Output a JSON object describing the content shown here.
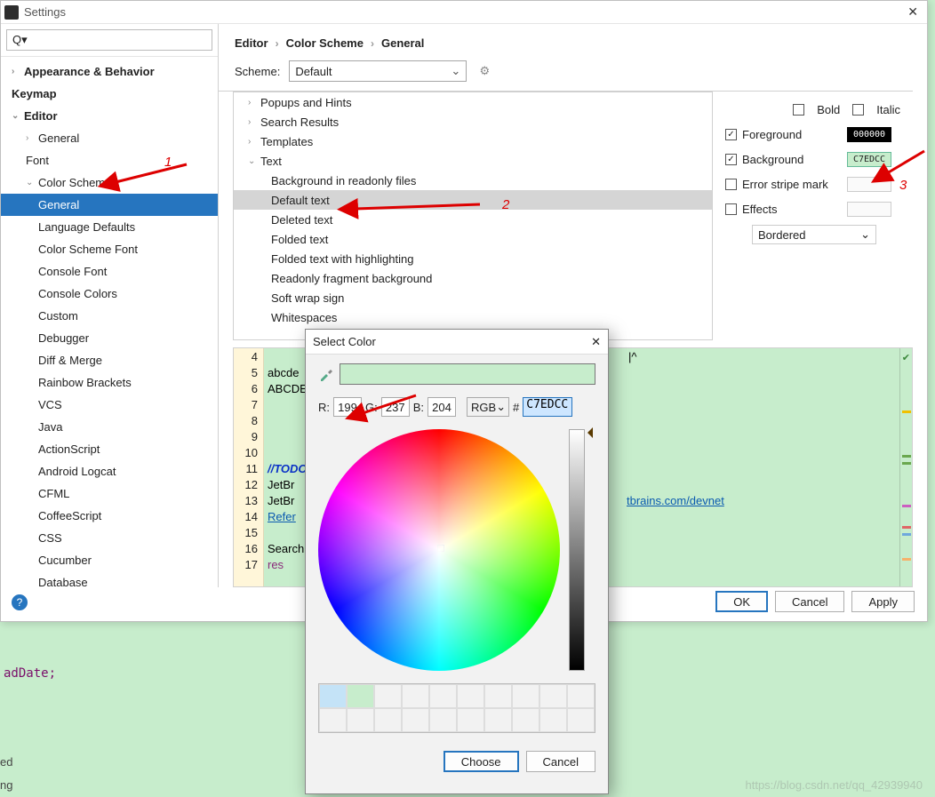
{
  "window": {
    "title": "Settings"
  },
  "search": {
    "placeholder": "Q▾"
  },
  "sidebar": {
    "items": [
      {
        "label": "Appearance & Behavior",
        "bold": true,
        "chev": ">",
        "lvl": 0
      },
      {
        "label": "Keymap",
        "bold": true,
        "lvl": 0
      },
      {
        "label": "Editor",
        "bold": true,
        "chev": "v",
        "lvl": 0
      },
      {
        "label": "General",
        "chev": ">",
        "lvl": 1
      },
      {
        "label": "Font",
        "lvl": 1
      },
      {
        "label": "Color Scheme",
        "chev": "v",
        "lvl": 1
      },
      {
        "label": "General",
        "lvl": 2,
        "sel": true
      },
      {
        "label": "Language Defaults",
        "lvl": 2
      },
      {
        "label": "Color Scheme Font",
        "lvl": 2
      },
      {
        "label": "Console Font",
        "lvl": 2
      },
      {
        "label": "Console Colors",
        "lvl": 2
      },
      {
        "label": "Custom",
        "lvl": 2
      },
      {
        "label": "Debugger",
        "lvl": 2
      },
      {
        "label": "Diff & Merge",
        "lvl": 2
      },
      {
        "label": "Rainbow Brackets",
        "lvl": 2
      },
      {
        "label": "VCS",
        "lvl": 2
      },
      {
        "label": "Java",
        "lvl": 2
      },
      {
        "label": "ActionScript",
        "lvl": 2
      },
      {
        "label": "Android Logcat",
        "lvl": 2
      },
      {
        "label": "CFML",
        "lvl": 2
      },
      {
        "label": "CoffeeScript",
        "lvl": 2
      },
      {
        "label": "CSS",
        "lvl": 2
      },
      {
        "label": "Cucumber",
        "lvl": 2
      },
      {
        "label": "Database",
        "lvl": 2
      }
    ]
  },
  "breadcrumbs": [
    "Editor",
    "Color Scheme",
    "General"
  ],
  "scheme": {
    "label": "Scheme:",
    "value": "Default"
  },
  "categories": [
    {
      "label": "Popups and Hints",
      "chev": ">"
    },
    {
      "label": "Search Results",
      "chev": ">"
    },
    {
      "label": "Templates",
      "chev": ">"
    },
    {
      "label": "Text",
      "chev": "v"
    },
    {
      "label": "Background in readonly files",
      "l": 1
    },
    {
      "label": "Default text",
      "l": 1,
      "sel": true
    },
    {
      "label": "Deleted text",
      "l": 1
    },
    {
      "label": "Folded text",
      "l": 1
    },
    {
      "label": "Folded text with highlighting",
      "l": 1
    },
    {
      "label": "Readonly fragment background",
      "l": 1
    },
    {
      "label": "Soft wrap sign",
      "l": 1
    },
    {
      "label": "Whitespaces",
      "l": 1
    }
  ],
  "props": {
    "bold": "Bold",
    "italic": "Italic",
    "fg": "Foreground",
    "fg_val": "000000",
    "bg": "Background",
    "bg_val": "C7EDCC",
    "stripe": "Error stripe mark",
    "effects": "Effects",
    "effects_sel": "Bordered"
  },
  "editor": {
    "lines": [
      "4",
      "5",
      "6",
      "7",
      "8",
      "9",
      "10",
      "11",
      "12",
      "13",
      "14",
      "15",
      "16",
      "17"
    ],
    "l5": "abcde",
    "l6": "ABCDE",
    "l11": "//TODO",
    "l12": "JetBr",
    "l13": "JetBr",
    "l14": "Refer",
    "l16": "Search",
    "l17": "  res",
    "tail": "tbrains.com/devnet",
    "caret": "|^"
  },
  "picker": {
    "title": "Select Color",
    "r_l": "R:",
    "r": "199",
    "g_l": "G:",
    "g": "237",
    "b_l": "B:",
    "b": "204",
    "mode": "RGB",
    "hash": "#",
    "hex": "C7EDCC",
    "choose": "Choose",
    "cancel": "Cancel"
  },
  "buttons": {
    "ok": "OK",
    "cancel": "Cancel",
    "apply": "Apply"
  },
  "annos": {
    "a1": "1",
    "a2": "2",
    "a3": "3"
  },
  "bgcode": "adDate;",
  "bg2": "ed",
  "bg3": "ng",
  "watermark": "https://blog.csdn.net/qq_42939940"
}
